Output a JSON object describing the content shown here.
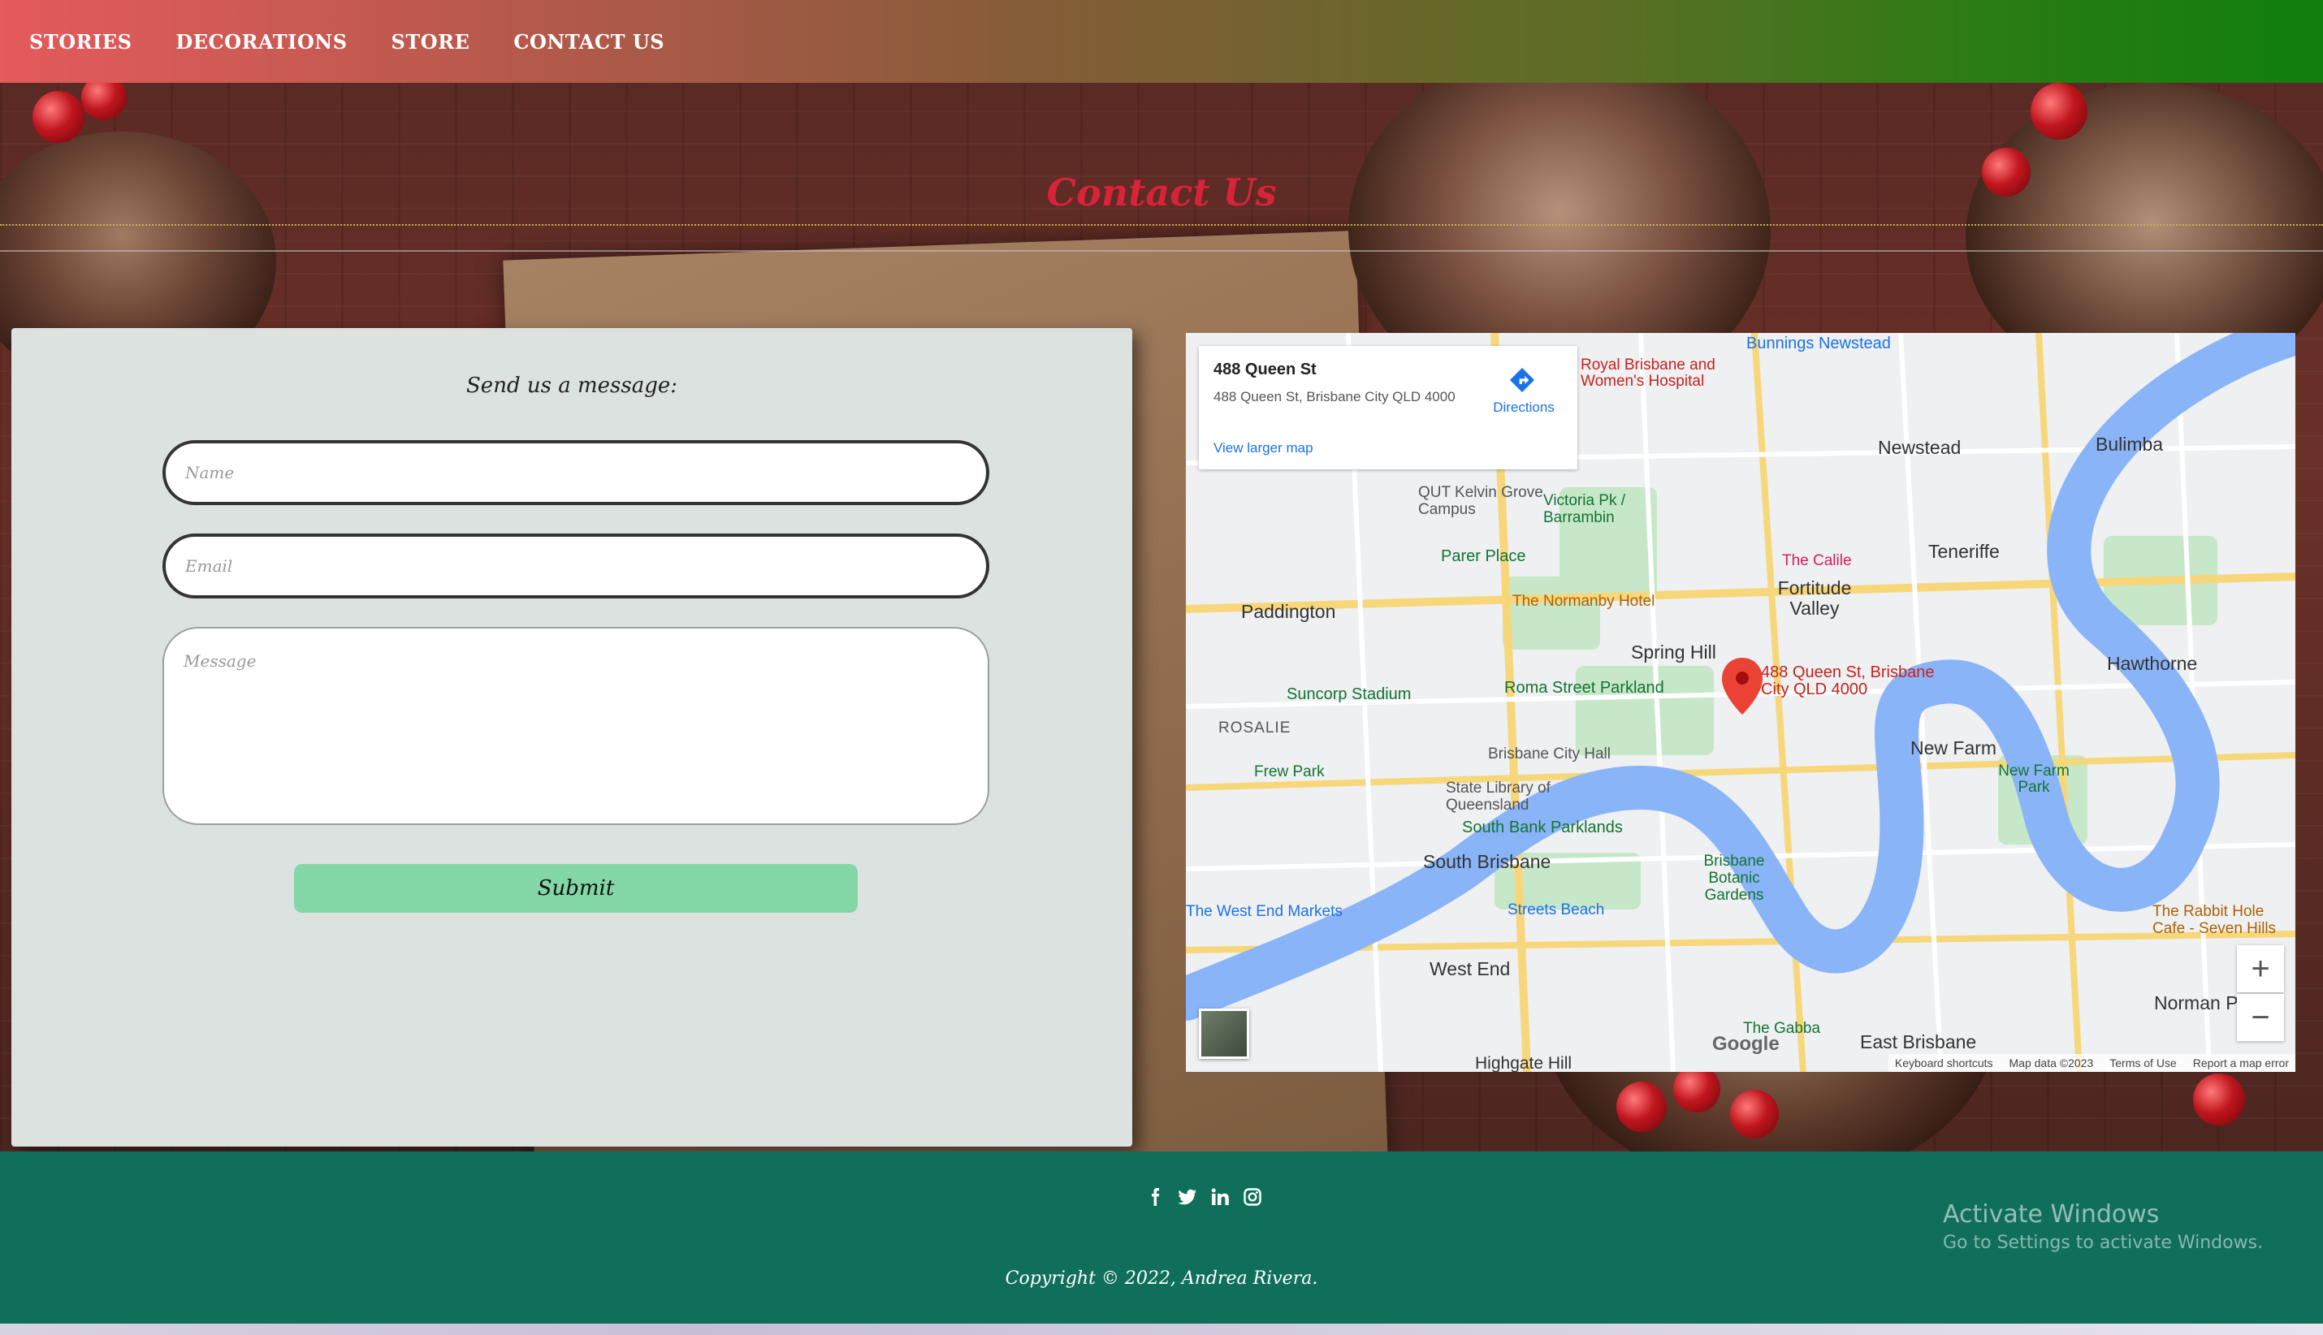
{
  "nav": {
    "items": [
      "STORIES",
      "DECORATIONS",
      "STORE",
      "CONTACT US"
    ]
  },
  "page": {
    "title": "Contact Us"
  },
  "form": {
    "heading": "Send us a message:",
    "name_placeholder": "Name",
    "email_placeholder": "Email",
    "message_placeholder": "Message",
    "submit_label": "Submit"
  },
  "map": {
    "card": {
      "title": "488 Queen St",
      "address": "488 Queen St, Brisbane City QLD 4000",
      "directions_label": "Directions",
      "larger_map_label": "View larger map"
    },
    "pin_label": "488 Queen St, Brisbane City QLD 4000",
    "labels": [
      "Bunnings Newstead",
      "Royal Brisbane and Women's Hospital",
      "Newstead",
      "Bulimba",
      "QUT Kelvin Grove Campus",
      "Victoria Pk / Barrambin",
      "Teneriffe",
      "The Calile",
      "Parer Place",
      "Fortitude Valley",
      "Paddington",
      "The Normanby Hotel",
      "Spring Hill",
      "Hawthorne",
      "Suncorp Stadium",
      "Roma Street Parkland",
      "ROSALIE",
      "New Farm",
      "Brisbane City Hall",
      "Frew Park",
      "New Farm Park",
      "State Library of Queensland",
      "South Bank Parklands",
      "South Brisbane",
      "Brisbane Botanic Gardens",
      "The West End Markets",
      "Streets Beach",
      "The Rabbit Hole Cafe - Seven Hills",
      "West End",
      "Norman P",
      "East Brisbane",
      "The Gabba",
      "Highgate Hill"
    ],
    "zoom_in": "+",
    "zoom_out": "−",
    "google": "Google",
    "attribution": [
      "Keyboard shortcuts",
      "Map data ©2023",
      "Terms of Use",
      "Report a map error"
    ]
  },
  "footer": {
    "social_icons": [
      "facebook-icon",
      "twitter-icon",
      "linkedin-icon",
      "instagram-icon"
    ],
    "copyright": "Copyright © 2022, Andrea Rivera."
  },
  "os_overlay": {
    "title": "Activate Windows",
    "subtitle": "Go to Settings to activate Windows."
  },
  "colors": {
    "nav_start": "#e55a5c",
    "nav_end": "#0f7f0c",
    "title": "#d8233a",
    "panel": "#dbe2df",
    "submit": "#83d6a6",
    "footer": "#106f5b"
  }
}
